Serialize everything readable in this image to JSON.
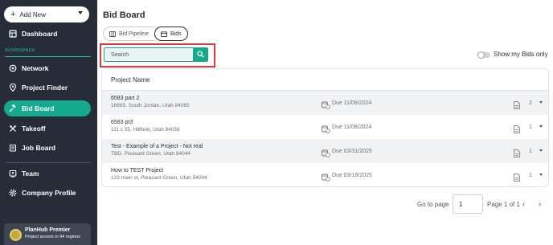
{
  "sidebar": {
    "add_new": "Add New",
    "dashboard": "Dashboard",
    "workspace_label": "WORKSPACE",
    "items": [
      {
        "label": "Network"
      },
      {
        "label": "Project Finder"
      },
      {
        "label": "Bid Board"
      },
      {
        "label": "Takeoff"
      },
      {
        "label": "Job Board"
      },
      {
        "label": "Team"
      },
      {
        "label": "Company Profile"
      }
    ],
    "premier": {
      "title": "PlanHub Premier",
      "subtitle": "Project access in 94 regions"
    }
  },
  "main": {
    "title": "Bid Board",
    "tabs": [
      {
        "label": "Bid Pipeline"
      },
      {
        "label": "Bids"
      }
    ],
    "search": {
      "placeholder": "Search",
      "value": ""
    },
    "toggle_label": "Show my Bids only",
    "table": {
      "header": "Project Name",
      "rows": [
        {
          "name": "6583 part 2",
          "address": "16665, South Jordan, Utah 84065",
          "due": "Due 11/09/2024",
          "count": "2"
        },
        {
          "name": "6583 pt3",
          "address": "111 s 55, Hillfield, Utah 84056",
          "due": "Due 11/08/2024",
          "count": "1"
        },
        {
          "name": "Test - Example of a Project - Not real",
          "address": "TBD, Pleasant Green, Utah 84044",
          "due": "Due 03/31/2025",
          "count": "1"
        },
        {
          "name": "How to TEST Project",
          "address": "123 main st, Pleasant Green, Utah 84044",
          "due": "Due 03/19/2025",
          "count": "1"
        }
      ]
    },
    "pagination": {
      "goto_label": "Go to page",
      "page_value": "1",
      "page_of": "Page 1 of 1"
    }
  },
  "colors": {
    "sidebar_bg": "#262d39",
    "accent": "#15a98f",
    "highlight": "#d9363e"
  }
}
